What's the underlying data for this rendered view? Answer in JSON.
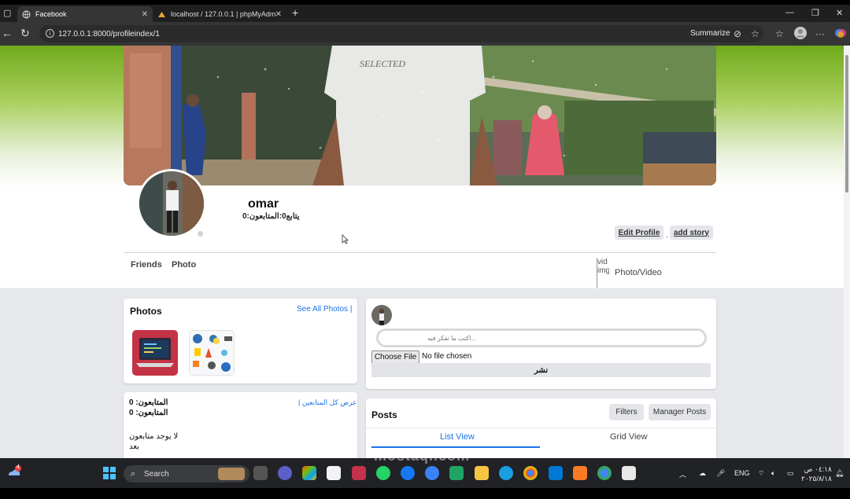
{
  "browser": {
    "tabs": [
      {
        "title": "Facebook",
        "active": true
      },
      {
        "title": "localhost / 127.0.0.1 | phpMyAdm",
        "active": false
      }
    ],
    "new_tab": "+",
    "url": "127.0.0.1:8000/profileindex/1",
    "summarize": "Summarize"
  },
  "profile": {
    "name": "omar",
    "stats": "0:يتابع0:المتابعون",
    "edit_profile": "Edit Profile",
    "separator": ".",
    "add_story": "add story",
    "tabs": [
      "Friends",
      "Photo"
    ],
    "photo_video_alt": "vid img",
    "photo_video": "Photo/Video"
  },
  "photos_card": {
    "title": "Photos",
    "see_all": "See All Photos |"
  },
  "followers_card": {
    "view_all": "| عرض كل المتابعين",
    "followers_line1": "المتابعون: 0",
    "followers_line2": "المتابعون: 0",
    "empty_line1": "لا يوجد متابعون",
    "empty_line2": "بعد"
  },
  "composer": {
    "placeholder": "...اكتب ما تفكر فيه",
    "choose_file": "Choose File",
    "no_file": "No file chosen",
    "publish": "نشر"
  },
  "posts": {
    "title": "Posts",
    "filters": "Filters",
    "manager": "Manager Posts",
    "list_view": "List View",
    "grid_view": "Grid View"
  },
  "taskbar": {
    "search": "Search",
    "lang": "ENG",
    "time": "٠٤:١٨ ص",
    "date": "٢٠٢٥/٨/١٨",
    "weather_badge": "4"
  },
  "watermark": "mostaql.com",
  "colors": {
    "accent": "#1a73e8",
    "cover_gradient_top": "#6faa1a"
  }
}
